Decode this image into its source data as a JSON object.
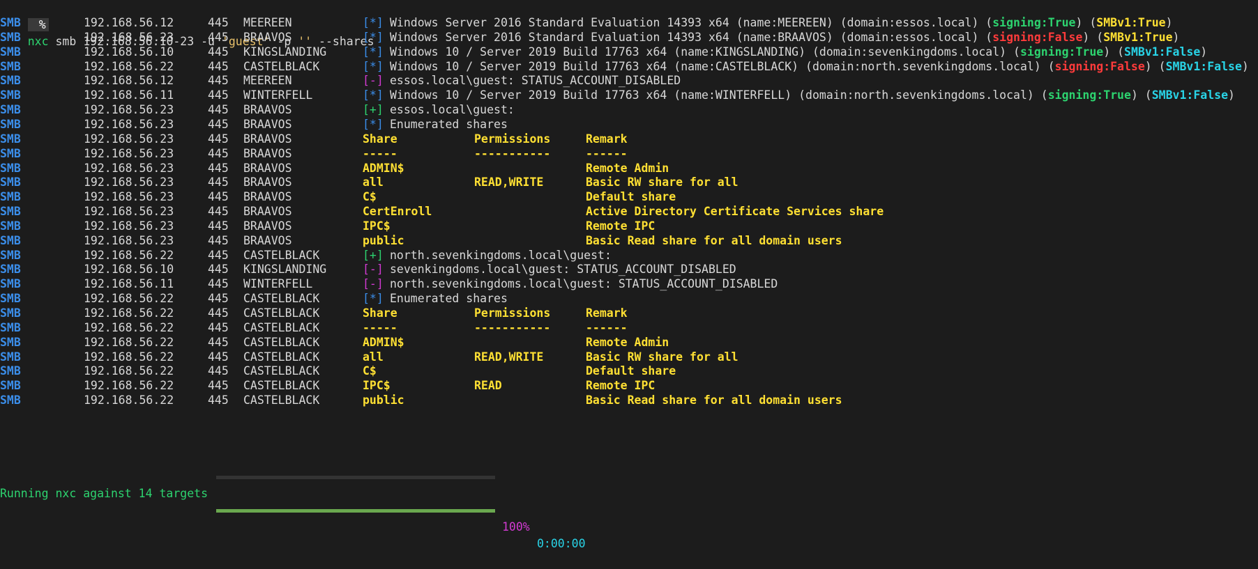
{
  "prompt": {
    "symbol": "%",
    "cmd_name": "nxc",
    "cmd_pre": " smb 192.168.56.10-23 -u ",
    "user": "'guest'",
    "cmd_mid": " -p ",
    "pass": "''",
    "cmd_post": " --shares"
  },
  "rows": [
    {
      "proto": "SMB",
      "ip": "192.168.56.12",
      "port": "445",
      "host": "MEEREEN",
      "kind": "info",
      "tag": "[*]",
      "msg": "Windows Server 2016 Standard Evaluation 14393 x64 (name:MEEREEN) (domain:essos.local) (",
      "signing": "signing:True",
      "signing_ok": true,
      "smbv1": "SMBv1:True",
      "smbv1_true": true
    },
    {
      "proto": "SMB",
      "ip": "192.168.56.23",
      "port": "445",
      "host": "BRAAVOS",
      "kind": "info",
      "tag": "[*]",
      "msg": "Windows Server 2016 Standard Evaluation 14393 x64 (name:BRAAVOS) (domain:essos.local) (",
      "signing": "signing:False",
      "signing_ok": false,
      "smbv1": "SMBv1:True",
      "smbv1_true": true
    },
    {
      "proto": "SMB",
      "ip": "192.168.56.10",
      "port": "445",
      "host": "KINGSLANDING",
      "kind": "info",
      "tag": "[*]",
      "msg": "Windows 10 / Server 2019 Build 17763 x64 (name:KINGSLANDING) (domain:sevenkingdoms.local) (",
      "signing": "signing:True",
      "signing_ok": true,
      "smbv1": "SMBv1:False",
      "smbv1_true": false
    },
    {
      "proto": "SMB",
      "ip": "192.168.56.22",
      "port": "445",
      "host": "CASTELBLACK",
      "kind": "info",
      "tag": "[*]",
      "msg": "Windows 10 / Server 2019 Build 17763 x64 (name:CASTELBLACK) (domain:north.sevenkingdoms.local) (",
      "signing": "signing:False",
      "signing_ok": false,
      "smbv1": "SMBv1:False",
      "smbv1_true": false
    },
    {
      "proto": "SMB",
      "ip": "192.168.56.12",
      "port": "445",
      "host": "MEEREEN",
      "kind": "bad",
      "tag": "[-]",
      "msg": "essos.local\\guest: STATUS_ACCOUNT_DISABLED"
    },
    {
      "proto": "SMB",
      "ip": "192.168.56.11",
      "port": "445",
      "host": "WINTERFELL",
      "kind": "info",
      "tag": "[*]",
      "msg": "Windows 10 / Server 2019 Build 17763 x64 (name:WINTERFELL) (domain:north.sevenkingdoms.local) (",
      "signing": "signing:True",
      "signing_ok": true,
      "smbv1": "SMBv1:False",
      "smbv1_true": false
    },
    {
      "proto": "SMB",
      "ip": "192.168.56.23",
      "port": "445",
      "host": "BRAAVOS",
      "kind": "ok",
      "tag": "[+]",
      "msg": "essos.local\\guest:"
    },
    {
      "proto": "SMB",
      "ip": "192.168.56.23",
      "port": "445",
      "host": "BRAAVOS",
      "kind": "info",
      "tag": "[*]",
      "msg": "Enumerated shares"
    },
    {
      "proto": "SMB",
      "ip": "192.168.56.23",
      "port": "445",
      "host": "BRAAVOS",
      "kind": "share",
      "share": "Share",
      "perm": "Permissions",
      "remark": "Remark"
    },
    {
      "proto": "SMB",
      "ip": "192.168.56.23",
      "port": "445",
      "host": "BRAAVOS",
      "kind": "share",
      "share": "-----",
      "perm": "-----------",
      "remark": "------"
    },
    {
      "proto": "SMB",
      "ip": "192.168.56.23",
      "port": "445",
      "host": "BRAAVOS",
      "kind": "share",
      "share": "ADMIN$",
      "perm": "",
      "remark": "Remote Admin"
    },
    {
      "proto": "SMB",
      "ip": "192.168.56.23",
      "port": "445",
      "host": "BRAAVOS",
      "kind": "share",
      "share": "all",
      "perm": "READ,WRITE",
      "remark": "Basic RW share for all"
    },
    {
      "proto": "SMB",
      "ip": "192.168.56.23",
      "port": "445",
      "host": "BRAAVOS",
      "kind": "share",
      "share": "C$",
      "perm": "",
      "remark": "Default share"
    },
    {
      "proto": "SMB",
      "ip": "192.168.56.23",
      "port": "445",
      "host": "BRAAVOS",
      "kind": "share",
      "share": "CertEnroll",
      "perm": "",
      "remark": "Active Directory Certificate Services share"
    },
    {
      "proto": "SMB",
      "ip": "192.168.56.23",
      "port": "445",
      "host": "BRAAVOS",
      "kind": "share",
      "share": "IPC$",
      "perm": "",
      "remark": "Remote IPC"
    },
    {
      "proto": "SMB",
      "ip": "192.168.56.23",
      "port": "445",
      "host": "BRAAVOS",
      "kind": "share",
      "share": "public",
      "perm": "",
      "remark": "Basic Read share for all domain users"
    },
    {
      "proto": "SMB",
      "ip": "192.168.56.22",
      "port": "445",
      "host": "CASTELBLACK",
      "kind": "ok",
      "tag": "[+]",
      "msg": "north.sevenkingdoms.local\\guest:"
    },
    {
      "proto": "SMB",
      "ip": "192.168.56.10",
      "port": "445",
      "host": "KINGSLANDING",
      "kind": "bad",
      "tag": "[-]",
      "msg": "sevenkingdoms.local\\guest: STATUS_ACCOUNT_DISABLED"
    },
    {
      "proto": "SMB",
      "ip": "192.168.56.11",
      "port": "445",
      "host": "WINTERFELL",
      "kind": "bad",
      "tag": "[-]",
      "msg": "north.sevenkingdoms.local\\guest: STATUS_ACCOUNT_DISABLED"
    },
    {
      "proto": "SMB",
      "ip": "192.168.56.22",
      "port": "445",
      "host": "CASTELBLACK",
      "kind": "info",
      "tag": "[*]",
      "msg": "Enumerated shares"
    },
    {
      "proto": "SMB",
      "ip": "192.168.56.22",
      "port": "445",
      "host": "CASTELBLACK",
      "kind": "share",
      "share": "Share",
      "perm": "Permissions",
      "remark": "Remark"
    },
    {
      "proto": "SMB",
      "ip": "192.168.56.22",
      "port": "445",
      "host": "CASTELBLACK",
      "kind": "share",
      "share": "-----",
      "perm": "-----------",
      "remark": "------"
    },
    {
      "proto": "SMB",
      "ip": "192.168.56.22",
      "port": "445",
      "host": "CASTELBLACK",
      "kind": "share",
      "share": "ADMIN$",
      "perm": "",
      "remark": "Remote Admin"
    },
    {
      "proto": "SMB",
      "ip": "192.168.56.22",
      "port": "445",
      "host": "CASTELBLACK",
      "kind": "share",
      "share": "all",
      "perm": "READ,WRITE",
      "remark": "Basic RW share for all"
    },
    {
      "proto": "SMB",
      "ip": "192.168.56.22",
      "port": "445",
      "host": "CASTELBLACK",
      "kind": "share",
      "share": "C$",
      "perm": "",
      "remark": "Default share"
    },
    {
      "proto": "SMB",
      "ip": "192.168.56.22",
      "port": "445",
      "host": "CASTELBLACK",
      "kind": "share",
      "share": "IPC$",
      "perm": "READ",
      "remark": "Remote IPC"
    },
    {
      "proto": "SMB",
      "ip": "192.168.56.22",
      "port": "445",
      "host": "CASTELBLACK",
      "kind": "share",
      "share": "public",
      "perm": "",
      "remark": "Basic Read share for all domain users"
    }
  ],
  "progress": {
    "label": "Running nxc against 14 targets",
    "fraction": 1.0,
    "percent_text": "100%",
    "elapsed": "0:00:00"
  }
}
